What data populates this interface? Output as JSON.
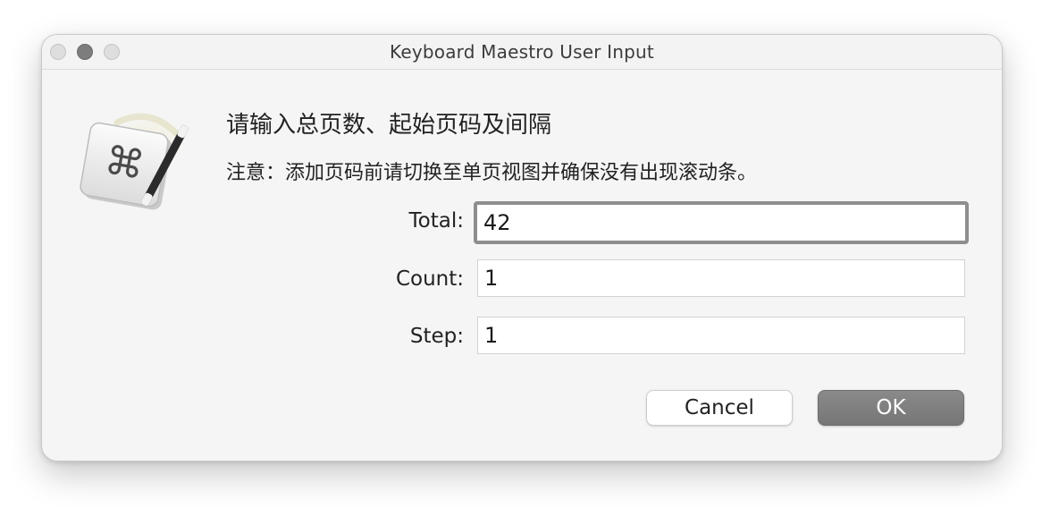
{
  "window": {
    "title": "Keyboard Maestro User Input"
  },
  "dialog": {
    "heading": "请输入总页数、起始页码及间隔",
    "note": "注意：添加页码前请切换至单页视图并确保没有出现滚动条。"
  },
  "fields": {
    "total": {
      "label": "Total:",
      "value": "42"
    },
    "count": {
      "label": "Count:",
      "value": "1"
    },
    "step": {
      "label": "Step:",
      "value": "1"
    }
  },
  "buttons": {
    "cancel_label": "Cancel",
    "ok_label": "OK"
  },
  "icons": {
    "app_icon": "keyboard-maestro-app-icon",
    "command_glyph": "⌘"
  },
  "colors": {
    "window_bg": "#f5f5f5",
    "focus_ring": "#8e8e8e",
    "default_button": "#7d7d7d"
  }
}
